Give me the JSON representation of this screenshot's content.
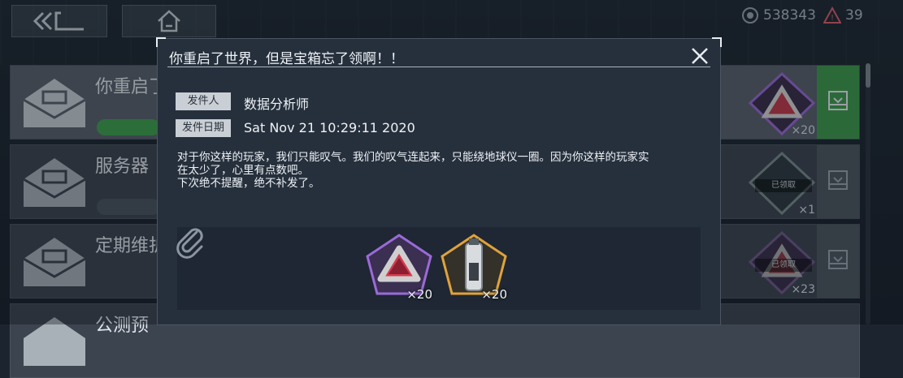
{
  "currencies": [
    {
      "icon": "coin-icon",
      "value": "538343"
    },
    {
      "icon": "alert-gem-icon",
      "value": "39"
    }
  ],
  "mail_list": [
    {
      "title": "你重启了",
      "reward_count": "×20",
      "claimed": false
    },
    {
      "title": "服务器",
      "reward_count": "×1",
      "claimed": true,
      "stamp": "已领取"
    },
    {
      "title": "定期维护",
      "reward_count": "×23",
      "claimed": true,
      "stamp": "已领取"
    },
    {
      "title": "公测预",
      "reward_count": "",
      "claimed": false
    }
  ],
  "modal": {
    "title": "你重启了世界，但是宝箱忘了领啊！！",
    "sender_label": "发件人",
    "sender": "数据分析师",
    "date_label": "发件日期",
    "date": "Sat Nov 21 10:29:11 2020",
    "body": "对于你这样的玩家，我们只能叹气。我们的叹气连起来，只能绕地球仪一圈。因为你这样的玩家实\n在太少了，心里有点数吧。\n下次绝不提醒，绝不补发了。",
    "attachments": [
      {
        "icon": "red-crystal-icon",
        "count": "×20",
        "rarity_color": "#9b6ad8"
      },
      {
        "icon": "capsule-device-icon",
        "count": "×20",
        "rarity_color": "#e0a23a"
      }
    ]
  }
}
